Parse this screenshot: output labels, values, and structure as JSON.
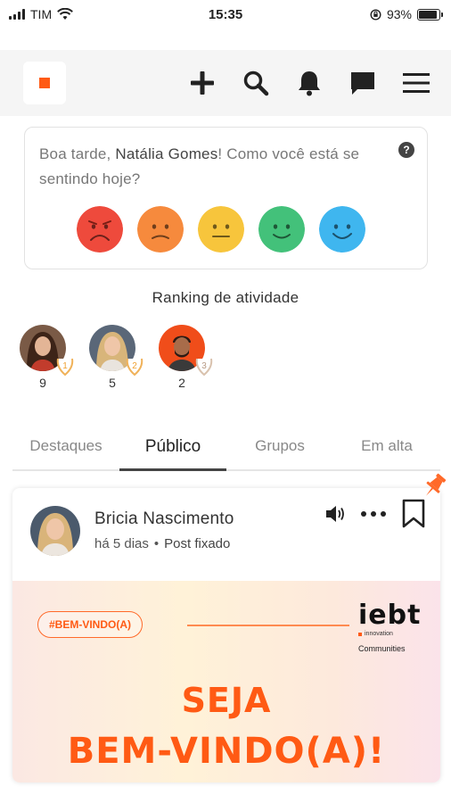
{
  "status_bar": {
    "carrier": "TIM",
    "time": "15:35",
    "battery_percent": "93%",
    "battery_level": 0.93
  },
  "header": {
    "icons": [
      "add-icon",
      "search-icon",
      "bell-icon",
      "chat-icon",
      "menu-icon"
    ],
    "accent_color": "#ff5a14"
  },
  "mood": {
    "greeting_prefix": "Boa tarde, ",
    "user_name": "Natália Gomes",
    "greeting_suffix": "! Como você está se sentindo hoje?",
    "help_label": "?",
    "faces": [
      {
        "name": "very-sad-face-icon",
        "color": "#ee4a3c"
      },
      {
        "name": "sad-face-icon",
        "color": "#f68a3d"
      },
      {
        "name": "neutral-face-icon",
        "color": "#f7c53c"
      },
      {
        "name": "happy-face-icon",
        "color": "#43c17a"
      },
      {
        "name": "very-happy-face-icon",
        "color": "#3fb6ef"
      }
    ]
  },
  "ranking": {
    "title": "Ranking de atividade",
    "items": [
      {
        "position": "1",
        "count": "9"
      },
      {
        "position": "2",
        "count": "5"
      },
      {
        "position": "3",
        "count": "2"
      }
    ]
  },
  "tabs": [
    {
      "label": "Destaques",
      "active": false
    },
    {
      "label": "Público",
      "active": true
    },
    {
      "label": "Grupos",
      "active": false
    },
    {
      "label": "Em alta",
      "active": false
    }
  ],
  "post": {
    "author": "Bricia Nascimento",
    "time_ago": "há 5 dias",
    "separator": "•",
    "pinned_label": "Post fixado",
    "image": {
      "badge": "#BEM-VINDO(A)",
      "brand": "iebt",
      "brand_sub": "innovation",
      "brand_communities": "Communities",
      "headline_1": "SEJA",
      "headline_2": "BEM-VINDO(A)!"
    }
  }
}
